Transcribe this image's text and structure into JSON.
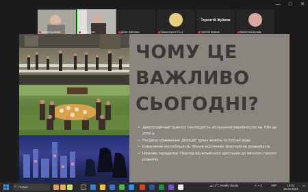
{
  "window": {
    "controls": [
      "—",
      "□",
      "✕"
    ]
  },
  "gallery": [
    {
      "name": "Оксана Кульбиф",
      "mic_muted": true,
      "has_video": true
    },
    {
      "name": "Тетяна Олег",
      "mic_muted": true,
      "has_video": true,
      "active": true
    },
    {
      "name": "Денис Няйлевич",
      "mic_muted": true,
      "has_video": false
    },
    {
      "name": "Галина Куля ПТЕ.Ц",
      "mic_muted": true,
      "has_video": false,
      "avatar_color": "#e6cf7a"
    },
    {
      "name": "Терентій Жуйков",
      "mic_muted": true,
      "has_video": false,
      "big_label": "Терентій Жуйков"
    },
    {
      "name": "Валентина Бульба",
      "mic_muted": true,
      "has_video": false,
      "avatar_color": "#d9a9a4"
    }
  ],
  "slide": {
    "title": "ЧОМУ ЦЕ ВАЖЛИВО СЬОГОДНІ?",
    "bullets": [
      "Демографічний прогноз: Необхідність збільшення виробництва на 70% до 2050 р.",
      "Ресурсні обмеження: Дефіцит орних земель та прісної води",
      "Кліматична нестабільність: Вплив екзогенних факторів на врожайність",
      "Наукова парадигма: Перехід від кількісного зростання до якісного сталого розвитку."
    ],
    "colors": {
      "background": "#8b8580",
      "title": "#3a3735",
      "text": "#f4f1ee"
    }
  },
  "taskbar": {
    "search_label": "Пошук",
    "weather": "11°C",
    "weather_desc": "Mostly cloudy",
    "language": "УКР",
    "time": "15:01",
    "date": "16.04.2024"
  }
}
